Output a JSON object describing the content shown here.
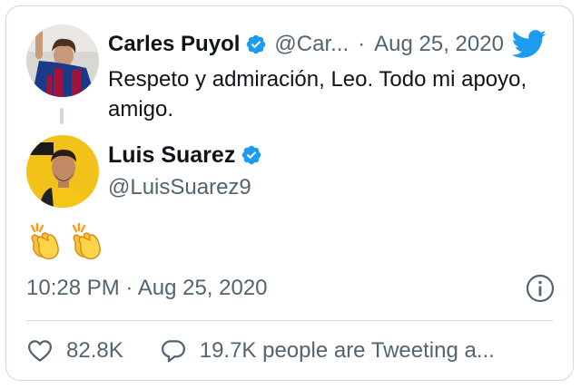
{
  "quoted_tweet": {
    "author_name": "Carles Puyol",
    "author_handle": "@Car...",
    "separator": "·",
    "date": "Aug 25, 2020",
    "text": "Respeto y admiración, Leo. Todo mi apoyo, amigo."
  },
  "tweet": {
    "author_name": "Luis Suarez",
    "author_handle": "@LuisSuarez9",
    "emoji": [
      "clapping-hands",
      "clapping-hands"
    ],
    "timestamp": "10:28 PM · Aug 25, 2020"
  },
  "actions": {
    "like_count": "82.8K",
    "reply_text": "19.7K people are Tweeting a..."
  },
  "colors": {
    "twitter_blue": "#1d9bf0",
    "text_primary": "#0f1419",
    "text_secondary": "#536471",
    "border": "#cfd9de"
  }
}
